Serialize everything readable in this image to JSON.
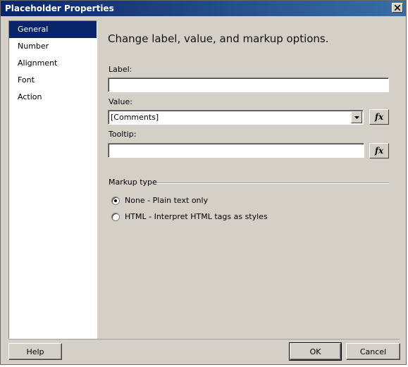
{
  "window": {
    "title": "Placeholder Properties"
  },
  "sidebar": {
    "items": [
      {
        "label": "General"
      },
      {
        "label": "Number"
      },
      {
        "label": "Alignment"
      },
      {
        "label": "Font"
      },
      {
        "label": "Action"
      }
    ],
    "selected": "General"
  },
  "main": {
    "heading": "Change label, value, and markup options.",
    "label_field": {
      "label": "Label:",
      "value": ""
    },
    "value_field": {
      "label": "Value:",
      "value": "[Comments]",
      "fx": "fx"
    },
    "tooltip_field": {
      "label": "Tooltip:",
      "value": "",
      "fx": "fx"
    },
    "markup": {
      "group_label": "Markup type",
      "options": [
        {
          "label": "None - Plain text only",
          "checked": true
        },
        {
          "label": "HTML - Interpret HTML tags as styles",
          "checked": false
        }
      ]
    }
  },
  "footer": {
    "help": "Help",
    "ok": "OK",
    "cancel": "Cancel"
  },
  "colors": {
    "selection": "#0a246a",
    "dialog_bg": "#d4d0c8"
  },
  "icons": {
    "close": "close-icon",
    "dropdown": "chevron-down-icon",
    "fx": "fx-icon"
  }
}
